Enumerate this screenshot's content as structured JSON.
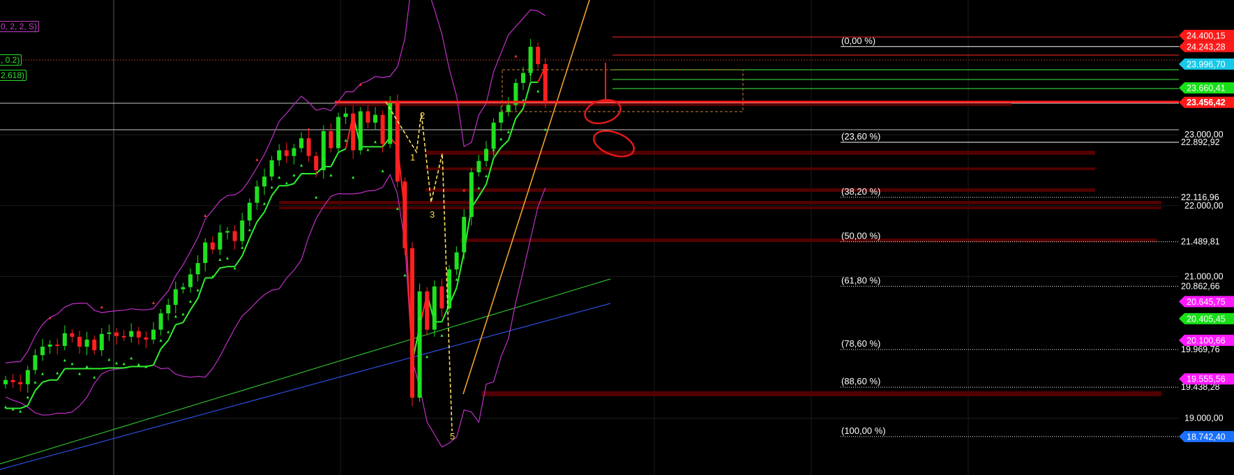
{
  "indicator_labels": [
    {
      "text": "0, 2, 2, S)",
      "color": "#c040c8"
    },
    {
      "text": ", 0.2)",
      "color": "#2de02d"
    },
    {
      "text": "2.618)",
      "color": "#2de02d"
    }
  ],
  "chart_data": {
    "type": "candlestick",
    "title": "",
    "ylim": [
      18200,
      24900
    ],
    "y_axis_ticks": [
      23000,
      22000,
      21000,
      19000
    ],
    "y_axis_tick_labels": [
      "23.000,00",
      "22.000,00",
      "21.000,00",
      "19.000,00"
    ],
    "price_tags": [
      {
        "value": 24400.15,
        "label": "24.400,15",
        "color": "#ff1a1a",
        "text_color": "#ffffff"
      },
      {
        "value": 24243.28,
        "label": "24.243,28",
        "color": "#ff1a1a",
        "text_color": "#ffffff"
      },
      {
        "value": 23996.7,
        "label": "23.996,70",
        "color": "#18c8e8",
        "text_color": "#ffffff"
      },
      {
        "value": 23660.41,
        "label": "23.660,41",
        "color": "#18e018",
        "text_color": "#ffffff"
      },
      {
        "value": 23456.42,
        "label": "23.456,42",
        "color": "#ff1a1a",
        "text_color": "#ffffff",
        "bold": true
      },
      {
        "value": 20645.75,
        "label": "20.645,75",
        "color": "#ff1aff",
        "text_color": "#ffffff"
      },
      {
        "value": 20405.45,
        "label": "20.405,45",
        "color": "#18e018",
        "text_color": "#ffffff"
      },
      {
        "value": 20100.66,
        "label": "20.100,66",
        "color": "#ff1aff",
        "text_color": "#ffffff"
      },
      {
        "value": 19555.56,
        "label": "19.555,56",
        "color": "#ff1aff",
        "text_color": "#ffffff"
      },
      {
        "value": 18742.4,
        "label": "18.742,40",
        "color": "#1a70ff",
        "text_color": "#ffffff"
      }
    ],
    "fibonacci": [
      {
        "label": "(0,00 %)",
        "value": 24243.28,
        "style": "solid",
        "axis_label": ""
      },
      {
        "label": "(23,60 %)",
        "value": 22892.92,
        "style": "solid",
        "axis_label": "22.892,92"
      },
      {
        "label": "(38,20 %)",
        "value": 22116.96,
        "style": "dotted",
        "axis_label": "22.116,96"
      },
      {
        "label": "(50,00 %)",
        "value": 21489.81,
        "style": "dotted",
        "axis_label": "21.489,81"
      },
      {
        "label": "(61,80 %)",
        "value": 20862.66,
        "style": "dotted",
        "axis_label": "20.862,66"
      },
      {
        "label": "(78,60 %)",
        "value": 19969.76,
        "style": "dotted",
        "axis_label": "19.969,76"
      },
      {
        "label": "(88,60 %)",
        "value": 19438.28,
        "style": "dotted",
        "axis_label": "19.438,28"
      },
      {
        "label": "(100,00 %)",
        "value": 18742.4,
        "style": "dotted",
        "axis_label": ""
      }
    ],
    "wave_labels": [
      {
        "text": "1",
        "price": 22950,
        "bar": 51
      },
      {
        "text": "2",
        "price": 23260,
        "bar": 52
      },
      {
        "text": "3",
        "price": 22000,
        "bar": 53
      },
      {
        "text": "5",
        "price": 18700,
        "bar": 55
      }
    ],
    "closes": [
      19540,
      19510,
      19480,
      19680,
      19890,
      20010,
      20040,
      20020,
      20200,
      20150,
      20010,
      20110,
      19960,
      20190,
      20210,
      20160,
      20150,
      20230,
      20140,
      20110,
      20250,
      20480,
      20600,
      20820,
      20850,
      21030,
      21190,
      21480,
      21380,
      21620,
      21640,
      21500,
      21790,
      22040,
      22270,
      22410,
      22640,
      22780,
      22700,
      22810,
      22950,
      22700,
      22500,
      23050,
      22810,
      23250,
      23300,
      22780,
      23330,
      23170,
      23280,
      22870,
      23460,
      22340,
      21400,
      19290,
      20790,
      20250,
      20860,
      20550,
      21100,
      21340,
      21840,
      22470,
      22630,
      22800,
      23170,
      23320,
      23420,
      23730,
      23870,
      24240,
      23996,
      23456
    ]
  }
}
